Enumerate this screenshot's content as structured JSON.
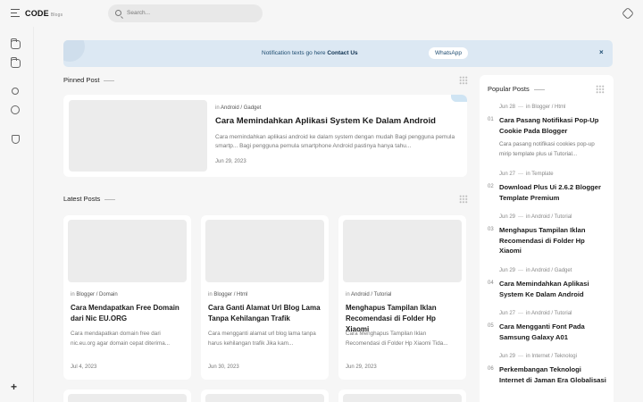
{
  "header": {
    "logo": "CODE",
    "logo_sub": "Blogs",
    "search_placeholder": "Search..."
  },
  "notification": {
    "text": "Notification texts go here",
    "link": "Contact Us",
    "button": "WhatsApp",
    "close": "×"
  },
  "pinned": {
    "section_title": "Pinned Post",
    "in": "in",
    "category": "Android / Gadget",
    "title": "Cara Memindahkan Aplikasi System Ke Dalam Android",
    "snippet": "Cara memindahkan aplikasi android ke dalam system dengan mudah Bagi pengguna pemula smartp... Bagi pengguna pemula smartphone Android pastinya hanya tahu...",
    "date": "Jun 29, 2023"
  },
  "latest": {
    "section_title": "Latest Posts",
    "posts": [
      {
        "in": "in",
        "category": "Blogger / Domain",
        "title": "Cara Mendapatkan Free Domain dari Nic EU.ORG",
        "snippet": "Cara mendapatkan domain free dari nic.eu.org agar domain cepat diterima...",
        "date": "Jul 4, 2023"
      },
      {
        "in": "in",
        "category": "Blogger / Html",
        "title": "Cara Ganti Alamat Url Blog Lama Tanpa Kehilangan Trafik",
        "snippet": "Cara mengganti alamat url blog lama tanpa harus kehilangan trafik Jika kam...",
        "date": "Jun 30, 2023"
      },
      {
        "in": "in",
        "category": "Android / Tutorial",
        "title": "Menghapus Tampilan Iklan Recomendasi di Folder Hp Xiaomi",
        "snippet": "Cara Menghapus Tampilan Iklan Recomendasi di Folder Hp Xiaomi Tida...",
        "date": "Jun 29, 2023"
      }
    ]
  },
  "popular": {
    "section_title": "Popular Posts",
    "items": [
      {
        "num": "01",
        "date": "Jun 28",
        "in": "in",
        "category": "Blogger / Html",
        "title": "Cara Pasang Notifikasi Pop-Up Cookie Pada Blogger",
        "snippet": "Cara pasang notifikasi cookies pop-up mirip template plus ui Tutorial..."
      },
      {
        "num": "02",
        "date": "Jun 27",
        "in": "in",
        "category": "Template",
        "title": "Download Plus Ui 2.6.2 Blogger Template Premium",
        "snippet": ""
      },
      {
        "num": "03",
        "date": "Jun 29",
        "in": "in",
        "category": "Android / Tutorial",
        "title": "Menghapus Tampilan Iklan Recomendasi di Folder Hp Xiaomi",
        "snippet": ""
      },
      {
        "num": "04",
        "date": "Jun 29",
        "in": "in",
        "category": "Android / Gadget",
        "title": "Cara Memindahkan Aplikasi System Ke Dalam Android",
        "snippet": ""
      },
      {
        "num": "05",
        "date": "Jun 27",
        "in": "in",
        "category": "Android / Tutorial",
        "title": "Cara Mengganti Font Pada Samsung Galaxy A01",
        "snippet": ""
      },
      {
        "num": "06",
        "date": "Jun 29",
        "in": "in",
        "category": "Internet / Teknologi",
        "title": "Perkembangan Teknologi Internet di Jaman Era Globalisasi",
        "snippet": ""
      }
    ]
  },
  "sidebar": {
    "plus": "+"
  }
}
